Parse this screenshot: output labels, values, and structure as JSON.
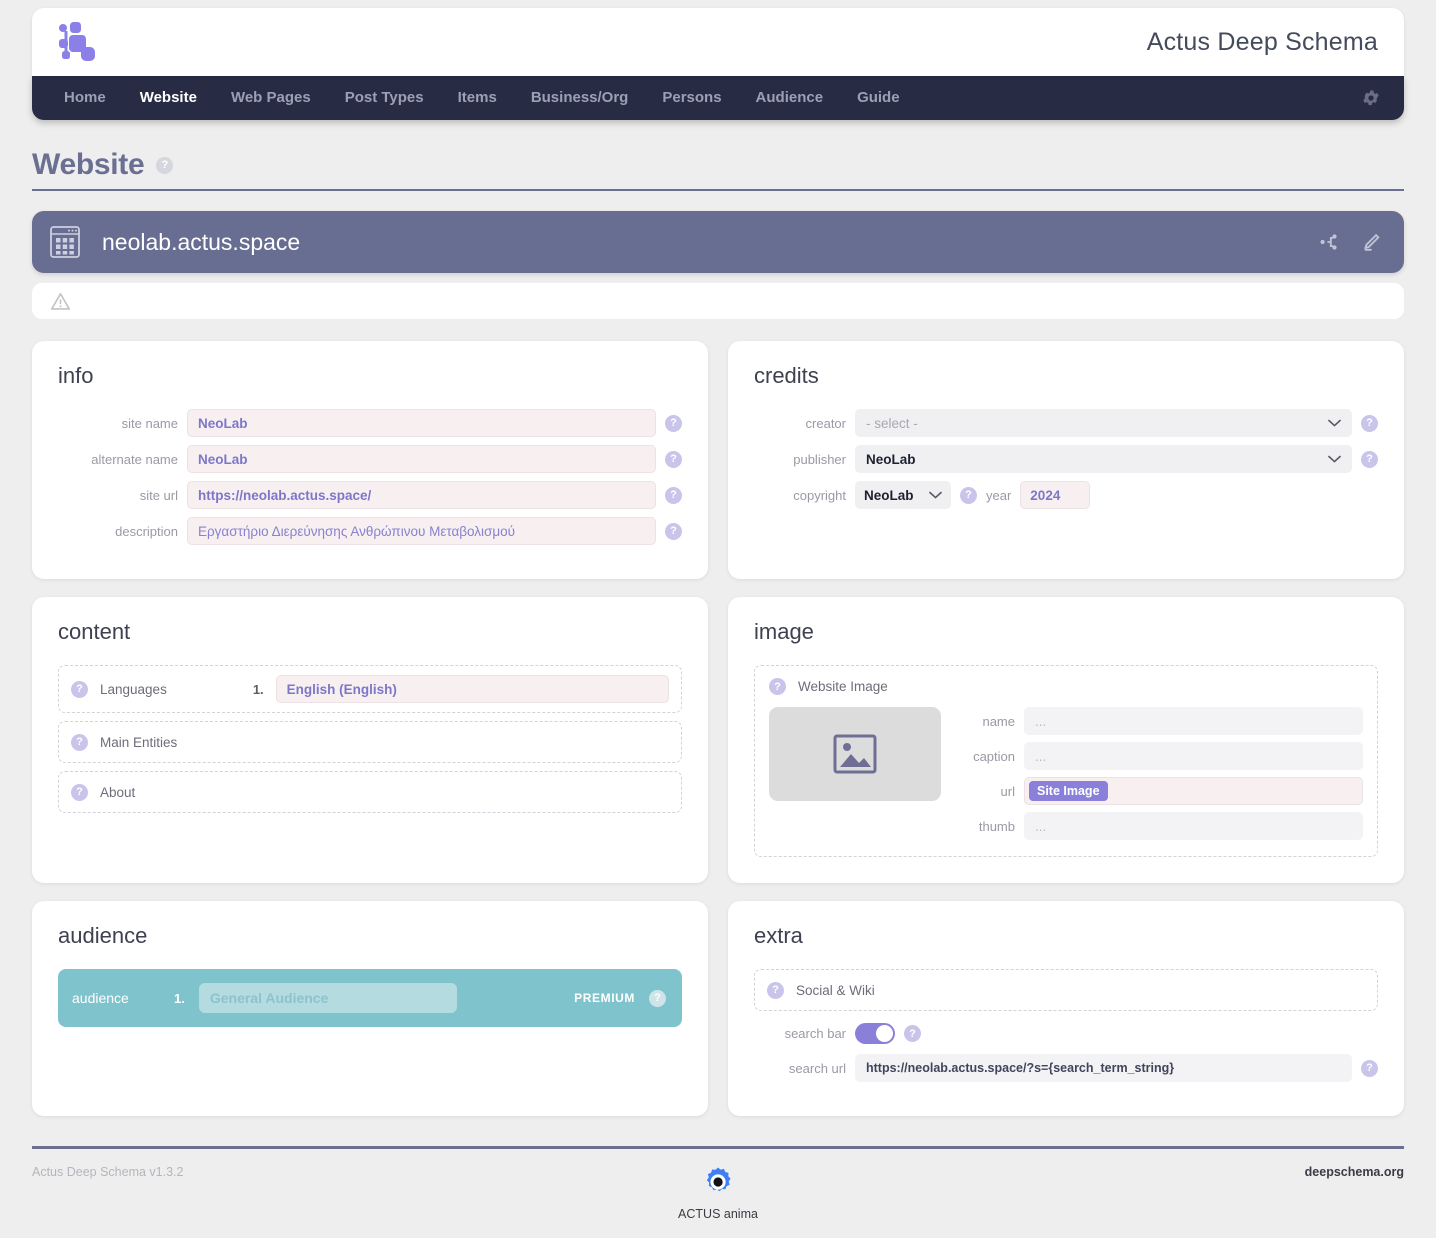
{
  "header": {
    "logo_icon": "network-node-logo",
    "app_title": "Actus Deep Schema",
    "gear_icon": "gear-icon"
  },
  "nav": {
    "items": [
      {
        "label": "Home",
        "active": false
      },
      {
        "label": "Website",
        "active": true
      },
      {
        "label": "Web Pages",
        "active": false
      },
      {
        "label": "Post Types",
        "active": false
      },
      {
        "label": "Items",
        "active": false
      },
      {
        "label": "Business/Org",
        "active": false
      },
      {
        "label": "Persons",
        "active": false
      },
      {
        "label": "Audience",
        "active": false
      },
      {
        "label": "Guide",
        "active": false
      }
    ]
  },
  "page": {
    "title": "Website",
    "help_glyph": "?"
  },
  "site_banner": {
    "icon": "browser-window-grid-icon",
    "name": "neolab.actus.space",
    "share_icon": "share-nodes-icon",
    "edit_icon": "pencil-edit-icon"
  },
  "warning_bar": {
    "icon": "warning-triangle-icon",
    "message": ""
  },
  "cards": {
    "info": {
      "title": "info",
      "fields": [
        {
          "label": "site name",
          "value": "NeoLab",
          "style": "filled"
        },
        {
          "label": "alternate name",
          "value": "NeoLab",
          "style": "filled"
        },
        {
          "label": "site url",
          "value": "https://neolab.actus.space/",
          "style": "filled"
        },
        {
          "label": "description",
          "value": "Εργαστήριο Διερεύνησης Ανθρώπινου Μεταβολισμού",
          "style": "greek"
        }
      ]
    },
    "credits": {
      "title": "credits",
      "creator_label": "creator",
      "creator_value": "- select -",
      "publisher_label": "publisher",
      "publisher_value": "NeoLab",
      "copyright_label": "copyright",
      "copyright_value": "NeoLab",
      "year_label": "year",
      "year_value": "2024"
    },
    "content": {
      "title": "content",
      "groups": [
        {
          "label": "Languages",
          "num": "1.",
          "value": "English (English)",
          "has_input": true
        },
        {
          "label": "Main Entities",
          "num": "",
          "value": "",
          "has_input": false
        },
        {
          "label": "About",
          "num": "",
          "value": "",
          "has_input": false
        }
      ]
    },
    "image": {
      "title": "image",
      "group_label": "Website Image",
      "thumb_icon": "image-placeholder-icon",
      "fields": [
        {
          "label": "name",
          "value": "...",
          "kind": "plain"
        },
        {
          "label": "caption",
          "value": "...",
          "kind": "plain"
        },
        {
          "label": "url",
          "value": "Site Image",
          "kind": "pill"
        },
        {
          "label": "thumb",
          "value": "...",
          "kind": "plain"
        }
      ]
    },
    "audience": {
      "title": "audience",
      "row_label": "audience",
      "row_num": "1.",
      "row_value": "General Audience",
      "badge": "PREMIUM"
    },
    "extra": {
      "title": "extra",
      "group_label": "Social & Wiki",
      "search_bar_label": "search bar",
      "search_bar_on": true,
      "search_url_label": "search url",
      "search_url_value": "https://neolab.actus.space/?s={search_term_string}"
    }
  },
  "footer": {
    "version": "Actus Deep Schema v1.3.2",
    "center_icon": "actus-gear-icon",
    "center_label": "ACTUS anima",
    "site": "deepschema.org"
  },
  "colors": {
    "nav_bg": "#282b44",
    "banner_bg": "#686d92",
    "accent_purple": "#8b80d9",
    "accent_lavender": "#7d77c9",
    "audience_teal": "#7fc3cc",
    "page_bg": "#eeeeee",
    "title_color": "#6b6f91"
  }
}
